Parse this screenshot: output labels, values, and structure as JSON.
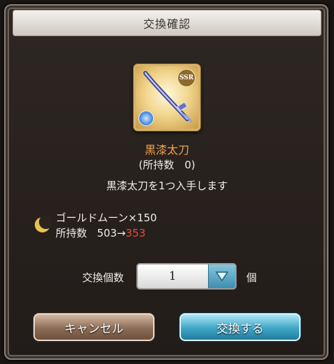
{
  "dialog": {
    "title": "交換確認"
  },
  "item": {
    "rarity": "SSR",
    "name": "黒漆太刀",
    "owned_text": "(所持数　0)",
    "acquire_text": "黒漆太刀を1つ入手します"
  },
  "cost": {
    "icon": "crescent-moon-icon",
    "currency_line": "ゴールドムーン×150",
    "owned_label": "所持数",
    "before": "503→",
    "after": "353",
    "after_color": "#e84a3a"
  },
  "quantity": {
    "label": "交換個数",
    "value": "1",
    "unit": "個"
  },
  "buttons": {
    "cancel": "キャンセル",
    "confirm": "交換する"
  },
  "colors": {
    "item_name": "#f1a24a",
    "confirm_accent": "#3fa6c7",
    "cancel_accent": "#8c6d56"
  }
}
